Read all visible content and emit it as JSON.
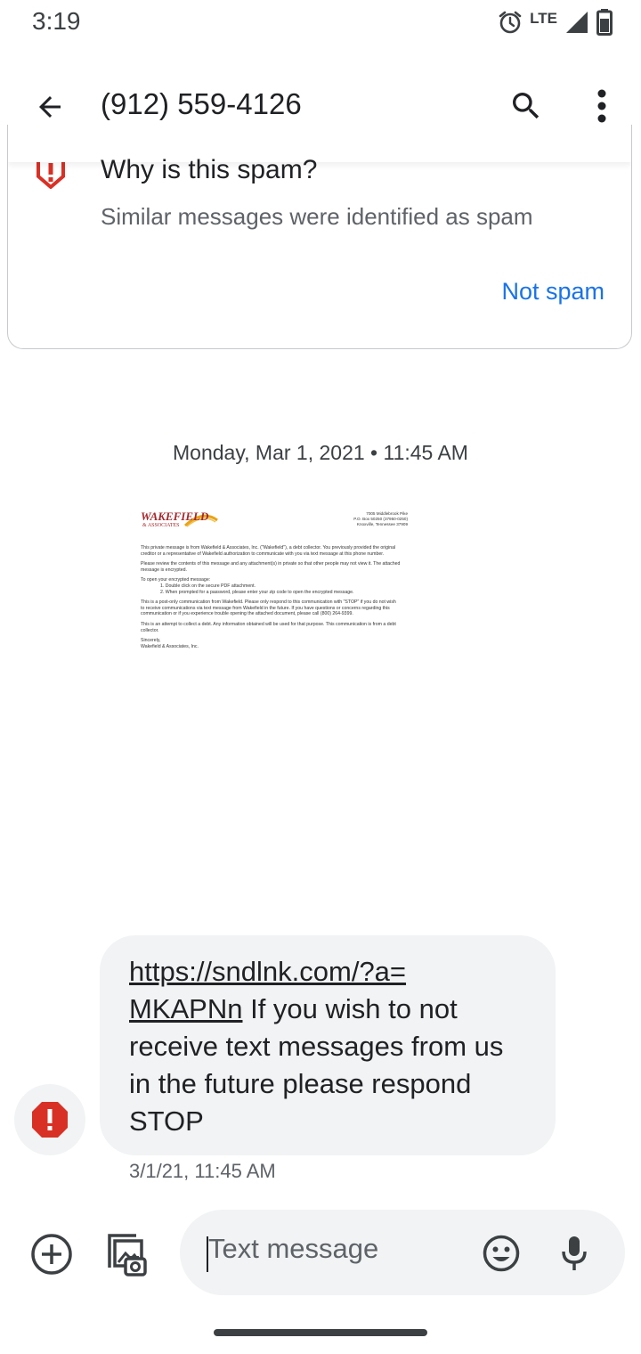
{
  "status_bar": {
    "time": "3:19",
    "network": "LTE",
    "icons": [
      "alarm-icon",
      "signal-icon",
      "battery-icon"
    ]
  },
  "app_bar": {
    "title": "(912) 559-4126",
    "icons": [
      "back-arrow-icon",
      "search-icon",
      "more-vert-icon"
    ]
  },
  "spam_card": {
    "title": "Why is this spam?",
    "description": "Similar messages were identified as spam",
    "action": "Not spam",
    "icon": "spam-warning-icon"
  },
  "conversation": {
    "date_separator": "Monday, Mar 1, 2021 • 11:45 AM",
    "attachment": {
      "logo_word": "WAKEFIELD",
      "logo_sub": "& ASSOCIATES",
      "address": [
        "7005 Middlebrook Pike",
        "P.O. Box 50250 (37950-0250)",
        "Knoxville, Tennessee 37909"
      ],
      "paragraphs": [
        "This private message is from Wakefield & Associates, Inc. (\"Wakefield\"), a debt collector. You previously provided the original creditor or a representative of Wakefield authorization to communicate with you via text message at this phone number.",
        "Please review the contents of this message and any attachment(s) in private so that other people may not view it. The attached message is encrypted.",
        "To open your encrypted message:",
        "1. Double click on the secure PDF attachment.",
        "2. When prompted for a password, please enter your zip code to open the encrypted message.",
        "This is a post-only communication from Wakefield. Please only respond to this communication with \"STOP\" if you do not wish to receive communications via text message from Wakefield in the future. If you have questions or concerns regarding this communication or if you experience trouble opening the attached document, please call (800) 264-9399.",
        "This is an attempt to collect a debt. Any information obtained will be used for that purpose. This communication is from a debt collector.",
        "Sincerely,",
        "Wakefield & Associates, Inc."
      ]
    },
    "message": {
      "link": "https://sndlnk.com/?a=MKAPNn",
      "link_line1": "https://sndlnk.com/?a=",
      "link_line2": "MKAPNn",
      "text": " If you wish to not receive text messages from us in the future please respond STOP",
      "timestamp": "3/1/21, 11:45 AM"
    }
  },
  "compose": {
    "placeholder": "Text message",
    "icons": [
      "add-circle-icon",
      "gallery-icon",
      "emoji-icon",
      "mic-icon"
    ]
  },
  "colors": {
    "accent": "#1a73e8",
    "spam_red": "#d93025",
    "bubble_bg": "#f1f3f4"
  }
}
